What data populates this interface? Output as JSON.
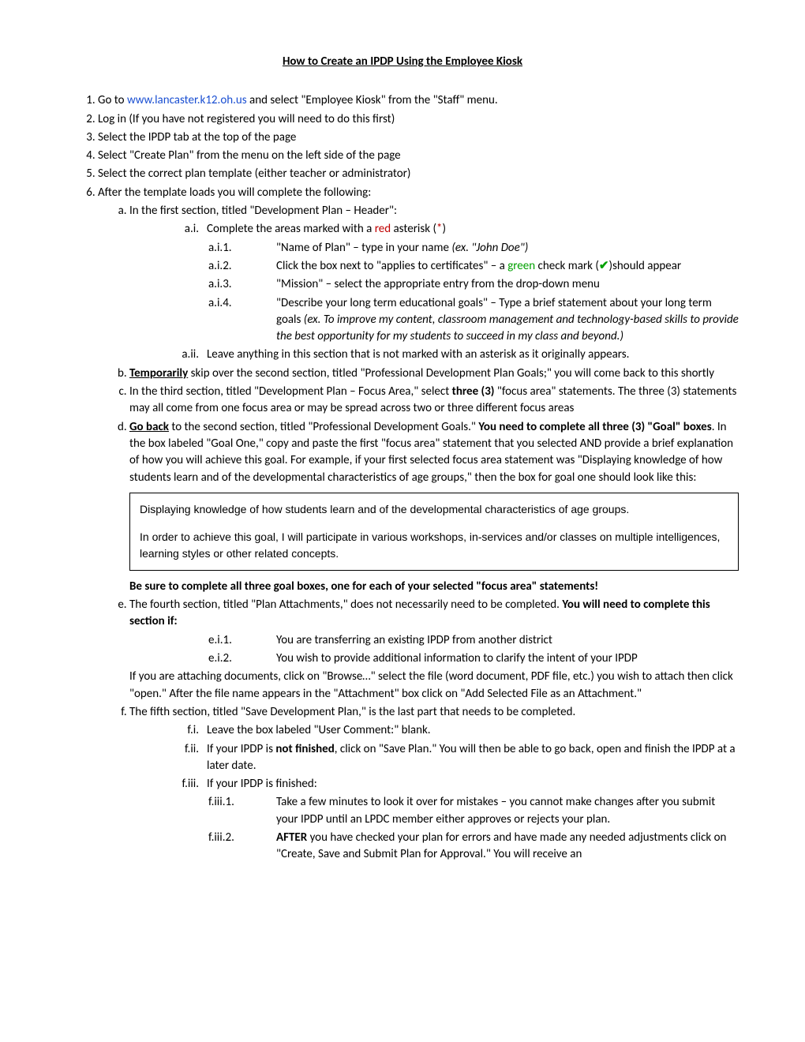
{
  "title": "How to Create an IPDP Using the Employee Kiosk",
  "step1_a": "Go to ",
  "step1_link": "www.lancaster.k12.oh.us",
  "step1_b": " and select \"Employee Kiosk\" from the \"Staff\" menu.",
  "step2": "Log in (If you have not registered you will need to do this first)",
  "step3": "Select the IPDP tab at the top of the page",
  "step4": "Select \"Create Plan\" from the menu on the left side of the page",
  "step5": "Select the correct plan template (either teacher or administrator)",
  "step6": "After the template loads you will complete the following:",
  "a_text": "In the first section, titled \"Development Plan – Header\":",
  "a_i_lbl": "a.i.",
  "a_i_a": "Complete the areas marked with a ",
  "a_i_red": "red",
  "a_i_b": " asterisk (",
  "a_i_star": "*",
  "a_i_c": ")",
  "a_i_1_lbl": "a.i.1.",
  "a_i_1_a": "\"Name of Plan\" – type in your name ",
  "a_i_1_i": "(ex. \"John Doe\")",
  "a_i_2_lbl": "a.i.2.",
  "a_i_2_a": "Click the box next to \"applies to certificates\" – a ",
  "a_i_2_green": "green",
  "a_i_2_b": " check mark (",
  "a_i_2_check": "✔",
  "a_i_2_c": ")should appear",
  "a_i_3_lbl": "a.i.3.",
  "a_i_3": "\"Mission\" – select the appropriate entry from the drop-down menu",
  "a_i_4_lbl": "a.i.4.",
  "a_i_4_a": "\"Describe your long term educational goals\" – Type a brief statement about your long term goals ",
  "a_i_4_i": "(ex. To improve my content, classroom management and technology-based skills to provide the best opportunity for my students to succeed in my class and beyond.)",
  "a_ii_lbl": "a.ii.",
  "a_ii": "Leave anything in this section that is not marked with an asterisk as it originally appears.",
  "b_bold": "Temporarily",
  "b_rest": " skip over the second section, titled \"Professional Development Plan Goals;\" you will come back to this shortly",
  "c_a": "In the third section, titled \"Development Plan – Focus Area,\" select ",
  "c_bold": "three (3)",
  "c_b": " \"focus area\" statements. The three (3) statements may all come from one focus area or may be spread across two or three different focus areas",
  "d_bold1": "Go back",
  "d_a": " to the second section, titled \"Professional Development Goals.\"  ",
  "d_bold2": "You need to complete all three (3) \"Goal\" boxes",
  "d_b": ".  In the box labeled \"Goal One,\" copy and paste the first \"focus area\" statement that you selected AND provide a brief explanation of how you will achieve this goal.  For example, if your first selected focus area statement was \"Displaying knowledge of how students learn and of the developmental characteristics of age groups,\" then the box for goal one should look like this:",
  "goalbox_p1": "Displaying knowledge of how students learn and of the developmental characteristics of age groups.",
  "goalbox_p2": "In order to achieve this goal, I will participate in various workshops, in-services and/or classes on multiple intelligences, learning styles or other related concepts.",
  "d_after": "Be sure to complete all three goal boxes, one for each of your selected \"focus area\" statements!",
  "e_a": "The fourth section, titled \"Plan Attachments,\" does not necessarily need to be completed.  ",
  "e_bold": "You will need to complete this section if:",
  "e_i_1_lbl": "e.i.1.",
  "e_i_1": "You are transferring an existing IPDP from another district",
  "e_i_2_lbl": "e.i.2.",
  "e_i_2": "You wish to provide additional information to clarify the intent of your IPDP",
  "e_tail": "If you are attaching documents, click on \"Browse…\" select the file (word document, PDF file, etc.) you wish to attach then click \"open.\"  After the file name appears in the \"Attachment\" box click on \"Add Selected File as an Attachment.\"",
  "f_text": "The fifth section, titled \"Save Development Plan,\" is the last part that needs to be completed.",
  "f_i_lbl": "f.i.",
  "f_i": "Leave the box labeled \"User Comment:\" blank.",
  "f_ii_lbl": "f.ii.",
  "f_ii_a": "If your IPDP is ",
  "f_ii_bold": "not finished",
  "f_ii_b": ", click on \"Save Plan.\"  You will then be able to go back, open and finish the IPDP at a later date.",
  "f_iii_lbl": "f.iii.",
  "f_iii": "If your IPDP is finished:",
  "f_iii_1_lbl": "f.iii.1.",
  "f_iii_1": "Take a few minutes to look it over for mistakes – you cannot make changes after you submit your IPDP until an LPDC member either approves or rejects your plan.",
  "f_iii_2_lbl": "f.iii.2.",
  "f_iii_2_bold": "AFTER",
  "f_iii_2": " you have checked your plan for errors and have made any needed adjustments click on \"Create, Save and Submit Plan for Approval.\" You will receive an"
}
